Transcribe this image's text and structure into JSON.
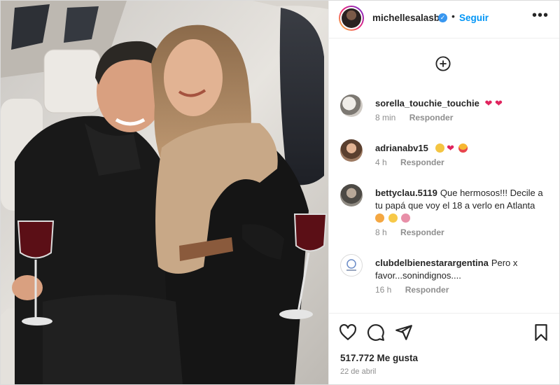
{
  "post": {
    "username": "michellesalasb",
    "follow_label": "Seguir",
    "separator": "•"
  },
  "comments": [
    {
      "user": "sorella_touchie_touchie",
      "text": "",
      "emojis": [
        "red-heart",
        "red-heart"
      ],
      "time": "8 min",
      "reply": "Responder"
    },
    {
      "user": "adrianabv15",
      "text": "",
      "emojis": [
        "clapping-hands",
        "red-heart",
        "heart-eyes-face"
      ],
      "time": "4 h",
      "reply": "Responder"
    },
    {
      "user": "bettyclau.5119",
      "text": "Que hermosos!!! Decile a tu papá que voy el 18 a verlo en Atlanta",
      "emojis": [
        "party-face",
        "grinning-face",
        "couple"
      ],
      "time": "8 h",
      "reply": "Responder"
    },
    {
      "user": "clubdelbienestarargentina",
      "text": "Pero x favor...sonindignos....",
      "emojis": [],
      "time": "16 h",
      "reply": "Responder"
    }
  ],
  "footer": {
    "likes": "517.772 Me gusta",
    "date": "22 de abril"
  },
  "icons": {
    "verified": "verified-badge-icon",
    "more": "more-options-icon",
    "add_comment": "add-circle-icon",
    "like": "heart-icon",
    "comment": "comment-icon",
    "share": "share-icon",
    "save": "bookmark-icon"
  },
  "colors": {
    "link_blue": "#0095f6",
    "verified_blue": "#3897f0",
    "heart_red": "#e0245e",
    "muted": "#8e8e8e"
  }
}
